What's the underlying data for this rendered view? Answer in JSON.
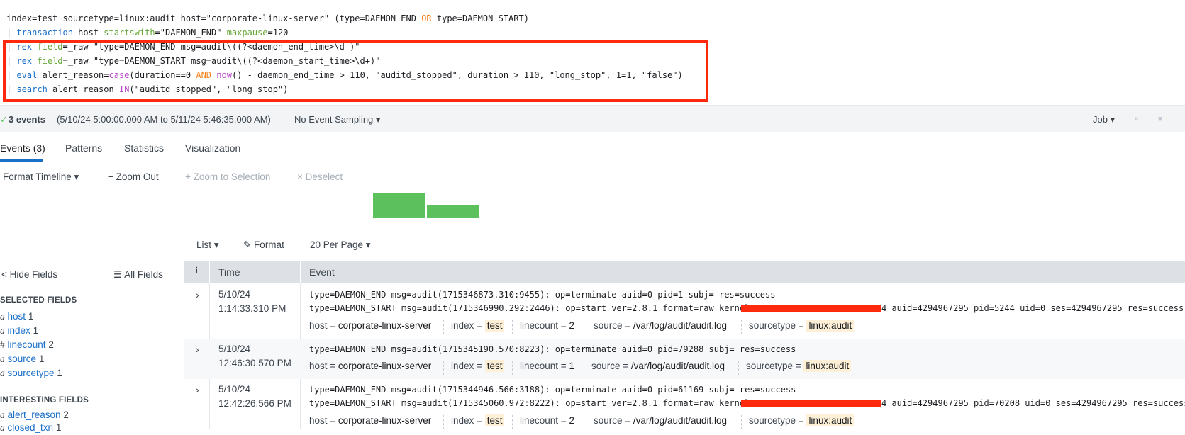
{
  "search": {
    "line1": {
      "a": "index=test sourcetype=linux:audit host=\"corporate-linux-server\" (type=DAEMON_END ",
      "or": "OR",
      "b": " type=DAEMON_START)"
    },
    "line2": {
      "pipe": "| ",
      "cmd": "transaction",
      "a": " host ",
      "arg1": "startswith",
      "b": "=\"DAEMON_END\" ",
      "arg2": "maxpause",
      "c": "=120"
    },
    "line3": {
      "pipe": "| ",
      "cmd": "rex",
      "a": " ",
      "arg": "field",
      "b": "=_raw \"type=DAEMON_END msg=audit\\((?<daemon_end_time>\\d+)\""
    },
    "line4": {
      "pipe": "| ",
      "cmd": "rex",
      "a": " ",
      "arg": "field",
      "b": "=_raw \"type=DAEMON_START msg=audit\\((?<daemon_start_time>\\d+)\""
    },
    "line5": {
      "pipe": "| ",
      "cmd": "eval",
      "a": " alert_reason=",
      "fn": "case",
      "b": "(duration==0 ",
      "and": "AND",
      "c": " ",
      "fn2": "now",
      "d": "() - daemon_end_time > 110, \"auditd_stopped\", duration > 110, \"long_stop\", 1=1, \"false\")"
    },
    "line6": {
      "pipe": "| ",
      "cmd": "search",
      "a": " alert_reason ",
      "in": "IN",
      "b": "(\"auditd_stopped\", \"long_stop\")"
    }
  },
  "status": {
    "check": "✓",
    "count": "3 events",
    "range": "(5/10/24 5:00:00.000 AM to 5/11/24 5:46:35.000 AM)",
    "sampling": "No Event Sampling ▾",
    "job": "Job ▾",
    "pause": "⏸",
    "stop": "■"
  },
  "tabs": [
    "Events (3)",
    "Patterns",
    "Statistics",
    "Visualization"
  ],
  "timeline_toolbar": {
    "format": "Format Timeline ▾",
    "zoom_out": "− Zoom Out",
    "zoom_sel": "+ Zoom to Selection",
    "deselect": "× Deselect"
  },
  "results_toolbar": {
    "list": "List ▾",
    "format": "✎ Format",
    "per_page": "20 Per Page ▾"
  },
  "sidebar": {
    "hide": "< Hide Fields",
    "all": "☰ All Fields",
    "selected_head": "SELECTED FIELDS",
    "selected": [
      {
        "type": "a",
        "name": "host",
        "count": "1"
      },
      {
        "type": "a",
        "name": "index",
        "count": "1"
      },
      {
        "type": "#",
        "name": "linecount",
        "count": "2"
      },
      {
        "type": "a",
        "name": "source",
        "count": "1"
      },
      {
        "type": "a",
        "name": "sourcetype",
        "count": "1"
      }
    ],
    "interesting_head": "INTERESTING FIELDS",
    "interesting": [
      {
        "type": "a",
        "name": "alert_reason",
        "count": "2"
      },
      {
        "type": "a",
        "name": "closed_txn",
        "count": "1"
      }
    ]
  },
  "table": {
    "col_i": "i",
    "col_time": "Time",
    "col_event": "Event",
    "rows": [
      {
        "date": "5/10/24",
        "time": "1:14:33.310 PM",
        "l1": "type=DAEMON_END msg=audit(1715346873.310:9455): op=terminate auid=0 pid=1 subj= res=success",
        "l2a": "type=DAEMON_START msg=audit(1715346990.292:2446): op=start ver=2.8.1 format=raw kernel=",
        "l2b": "4 auid=4294967295 pid=5244 uid=0 ses=4294967295 res=success",
        "host": "corporate-linux-server",
        "index": "test",
        "linecount": "2",
        "source": "/var/log/audit/audit.log",
        "sourcetype": "linux:audit"
      },
      {
        "date": "5/10/24",
        "time": "12:46:30.570 PM",
        "l1": "type=DAEMON_END msg=audit(1715345190.570:8223): op=terminate auid=0 pid=79288 subj= res=success",
        "host": "corporate-linux-server",
        "index": "test",
        "linecount": "1",
        "source": "/var/log/audit/audit.log",
        "sourcetype": "linux:audit"
      },
      {
        "date": "5/10/24",
        "time": "12:42:26.566 PM",
        "l1": "type=DAEMON_END msg=audit(1715344946.566:3188): op=terminate auid=0 pid=61169 subj= res=success",
        "l2a": "type=DAEMON_START msg=audit(1715345060.972:8222): op=start ver=2.8.1 format=raw kernel=",
        "l2b": "4 auid=4294967295 pid=70208 uid=0 ses=4294967295 res=success",
        "host": "corporate-linux-server",
        "index": "test",
        "linecount": "2",
        "source": "/var/log/audit/audit.log",
        "sourcetype": "linux:audit"
      }
    ],
    "labels": {
      "host": "host =",
      "index": "index =",
      "linecount": "linecount =",
      "source": "source =",
      "sourcetype": "sourcetype ="
    }
  }
}
